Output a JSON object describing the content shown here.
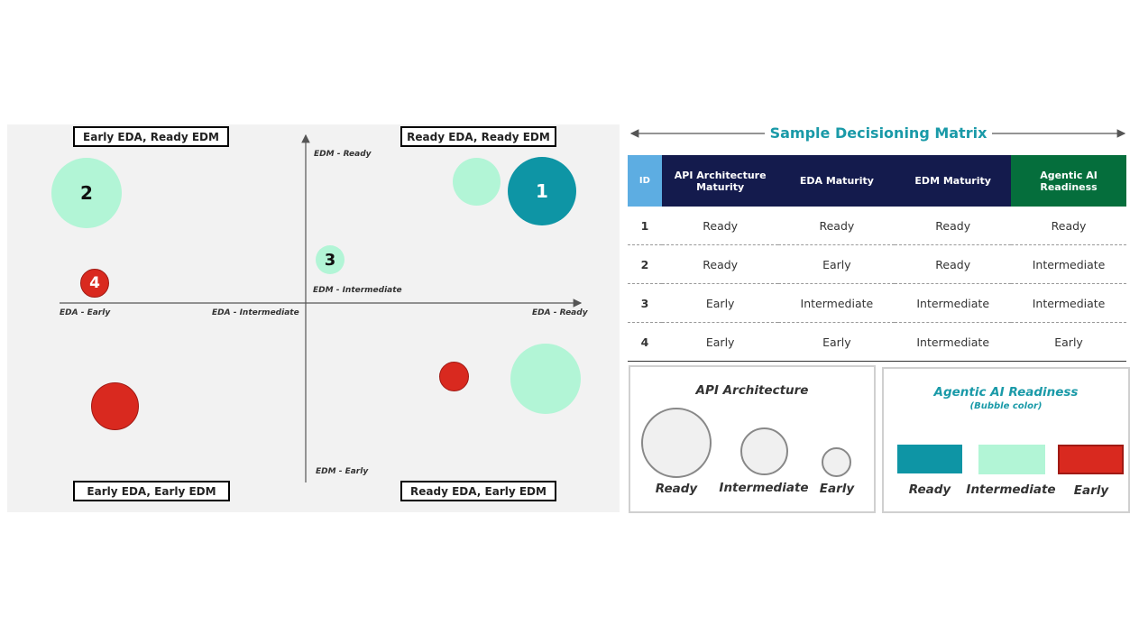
{
  "quadrant": {
    "labels": {
      "top_left": "Early EDA, Ready EDM",
      "top_right": "Ready EDA, Ready EDM",
      "bottom_left": "Early EDA, Early EDM",
      "bottom_right": "Ready EDA, Early EDM"
    },
    "axis": {
      "y_top": "EDM - Ready",
      "y_mid": "EDM - Intermediate",
      "y_bottom": "EDM - Early",
      "x_left": "EDA - Early",
      "x_mid": "EDA - Intermediate",
      "x_right": "EDA - Ready"
    },
    "bubbles": {
      "b1": "1",
      "b2": "2",
      "b3": "3",
      "b4": "4"
    }
  },
  "colors": {
    "ready": "#0e95a5",
    "intermediate": "#b2f5d6",
    "early": "#d9291f",
    "header_navy": "#141b4d",
    "header_id": "#5dade2",
    "header_green": "#056e3c",
    "accent": "#1a9aa8"
  },
  "matrix": {
    "title": "Sample Decisioning Matrix",
    "headers": [
      "ID",
      "API Architecture Maturity",
      "EDA Maturity",
      "EDM Maturity",
      "Agentic AI Readiness"
    ],
    "rows": [
      [
        "1",
        "Ready",
        "Ready",
        "Ready",
        "Ready"
      ],
      [
        "2",
        "Ready",
        "Early",
        "Ready",
        "Intermediate"
      ],
      [
        "3",
        "Early",
        "Intermediate",
        "Intermediate",
        "Intermediate"
      ],
      [
        "4",
        "Early",
        "Early",
        "Intermediate",
        "Early"
      ]
    ]
  },
  "legend_api": {
    "title": "API Architecture",
    "items": [
      "Ready",
      "Intermediate",
      "Early"
    ]
  },
  "legend_agentic": {
    "title": "Agentic AI Readiness",
    "subtitle": "(Bubble color)",
    "items": [
      "Ready",
      "Intermediate",
      "Early"
    ]
  }
}
